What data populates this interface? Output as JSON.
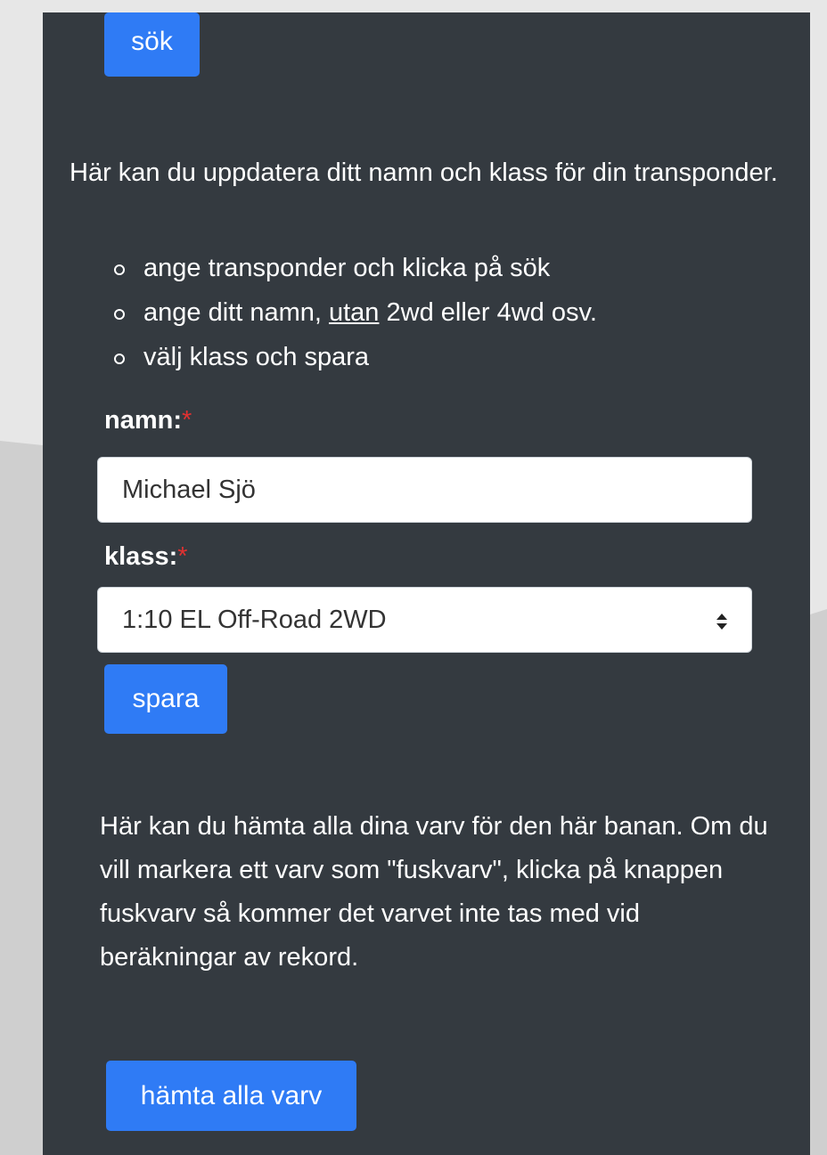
{
  "search": {
    "button_label": "sök"
  },
  "intro": {
    "text": "Här kan du uppdatera ditt namn och klass för din transponder.",
    "steps": [
      {
        "before": "ange transponder och klicka på sök",
        "emph": "",
        "after": ""
      },
      {
        "before": "ange ditt namn, ",
        "emph": "utan",
        "after": " 2wd eller 4wd osv."
      },
      {
        "before": "välj klass och spara",
        "emph": "",
        "after": ""
      }
    ]
  },
  "form": {
    "name_label": "namn:",
    "name_required_mark": "*",
    "name_value": "Michael Sjö",
    "class_label": "klass:",
    "class_required_mark": "*",
    "class_value": "1:10 EL Off-Road 2WD",
    "save_label": "spara"
  },
  "laps": {
    "text": "Här kan du hämta alla dina varv för den här banan. Om du vill markera ett varv som \"fuskvarv\", klicka på knappen fuskvarv så kommer det varvet inte tas med vid beräkningar av rekord.",
    "fetch_label": "hämta alla varv"
  },
  "colors": {
    "panel": "#343a40",
    "primary": "#2f7bf5",
    "required": "#e03131"
  }
}
